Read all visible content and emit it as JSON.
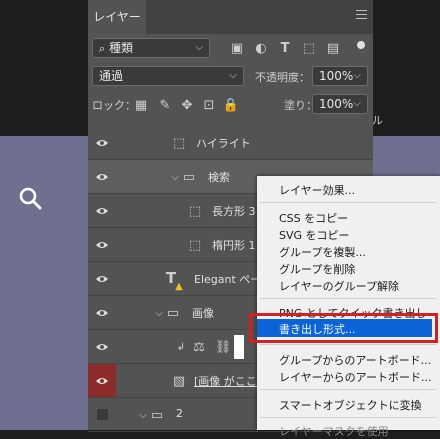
{
  "panel": {
    "tab_label": "レイヤー",
    "filter": {
      "value": "種類"
    },
    "blend_mode": "通過",
    "opacity_label": "不透明度：",
    "opacity_value": "100%",
    "lock_label": "ロック：",
    "fill_label": "塗り：",
    "fill_value": "100%"
  },
  "side_text": "ル",
  "layers": [
    {
      "name": "ハイライト",
      "visible": true
    },
    {
      "name": "検索",
      "visible": true,
      "type": "group"
    },
    {
      "name": "長方形 3",
      "visible": true
    },
    {
      "name": "楕円形 1",
      "visible": true
    },
    {
      "name": "Elegant ペー",
      "visible": true,
      "type": "text"
    },
    {
      "name": "画像",
      "visible": true,
      "type": "group"
    },
    {
      "name": "",
      "visible": true,
      "type": "smart"
    },
    {
      "name": "[画像 がここに",
      "visible": true,
      "highlight": true
    },
    {
      "name": "2",
      "visible": false,
      "type": "group"
    }
  ],
  "context_menu": {
    "items": [
      "レイヤー効果...",
      "CSS をコピー",
      "SVG をコピー",
      "グループを複製...",
      "グループを削除",
      "レイヤーのグループ解除",
      "PNG としてクイック書き出し",
      "書き出し形式...",
      "グループからのアートボード...",
      "レイヤーからのアートボード...",
      "スマートオブジェクトに変換",
      "レイヤーマスクを使用"
    ],
    "highlighted": "書き出し形式..."
  },
  "colors": {
    "highlight": "#0a64d8",
    "annotation": "#d42020",
    "canvas": "#6f6f90"
  }
}
